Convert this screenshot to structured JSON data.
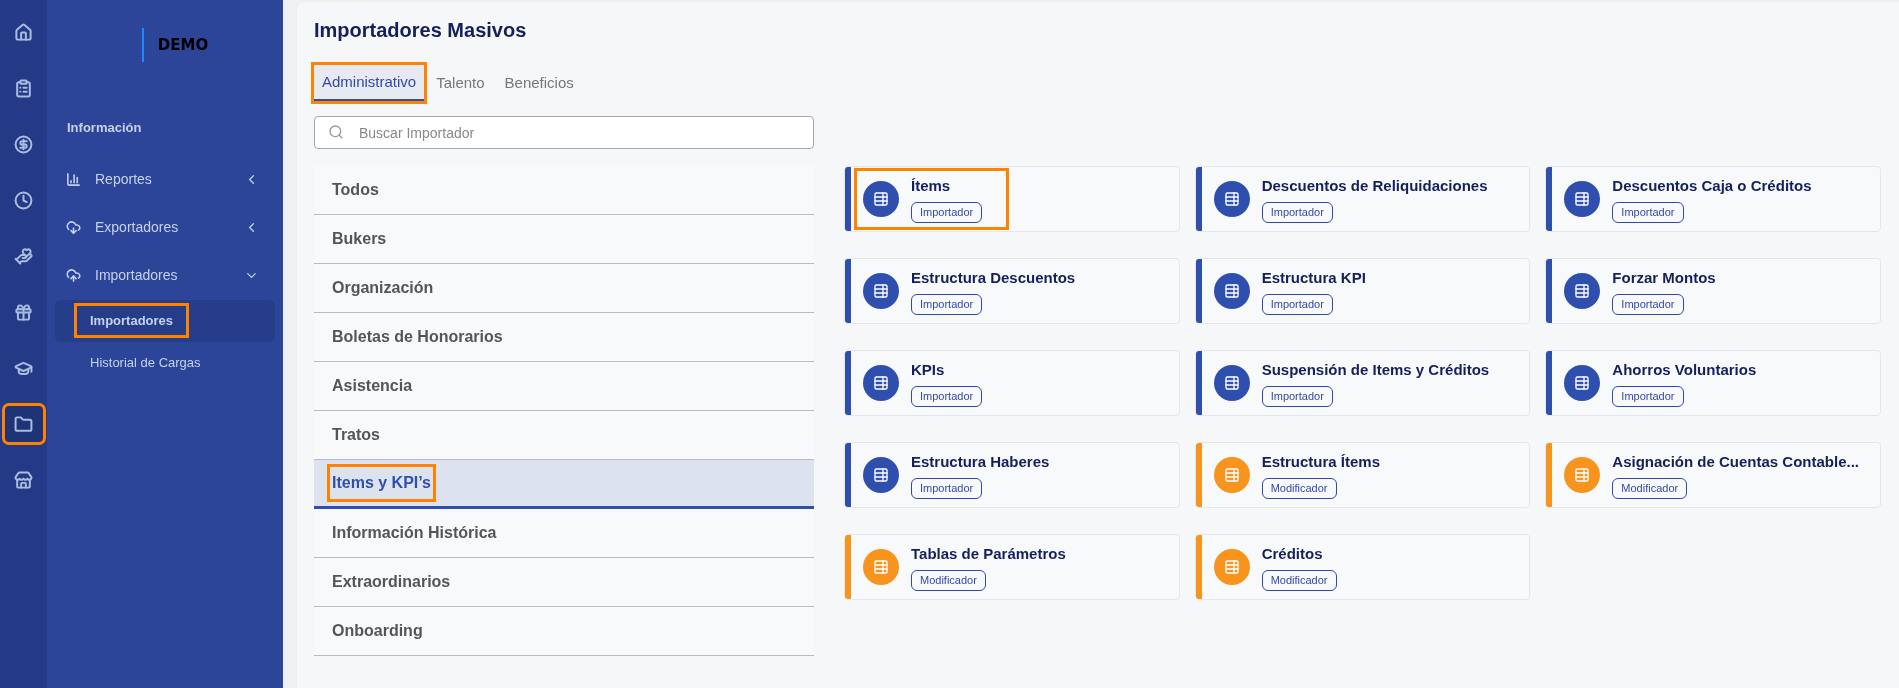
{
  "rail": [
    {
      "selected": false,
      "highlighted": false
    },
    {
      "selected": false,
      "highlighted": false
    },
    {
      "selected": false,
      "highlighted": false
    },
    {
      "selected": false,
      "highlighted": false
    },
    {
      "selected": false,
      "highlighted": false
    },
    {
      "selected": false,
      "highlighted": false
    },
    {
      "selected": false,
      "highlighted": false
    },
    {
      "selected": true,
      "highlighted": true
    },
    {
      "selected": false,
      "highlighted": false
    }
  ],
  "sidebar": {
    "logo": "DEMO",
    "section": "Información",
    "items": [
      {
        "label": "Reportes",
        "expanded": false
      },
      {
        "label": "Exportadores",
        "expanded": false
      },
      {
        "label": "Importadores",
        "expanded": true,
        "children": [
          {
            "label": "Importadores",
            "selected": true,
            "highlighted": true
          },
          {
            "label": "Historial de Cargas",
            "selected": false,
            "highlighted": false
          }
        ]
      }
    ]
  },
  "title": "Importadores Masivos",
  "tabs": [
    {
      "label": "Administrativo",
      "selected": true,
      "highlighted": true
    },
    {
      "label": "Talento",
      "selected": false,
      "highlighted": false
    },
    {
      "label": "Beneficios",
      "selected": false,
      "highlighted": false
    }
  ],
  "search": {
    "placeholder": "Buscar Importador"
  },
  "categories": [
    {
      "label": "Todos",
      "selected": false,
      "highlighted": false
    },
    {
      "label": "Bukers",
      "selected": false,
      "highlighted": false
    },
    {
      "label": "Organización",
      "selected": false,
      "highlighted": false
    },
    {
      "label": "Boletas de Honorarios",
      "selected": false,
      "highlighted": false
    },
    {
      "label": "Asistencia",
      "selected": false,
      "highlighted": false
    },
    {
      "label": "Tratos",
      "selected": false,
      "highlighted": false
    },
    {
      "label": "Items y KPI’s",
      "selected": true,
      "highlighted": true
    },
    {
      "label": "Información Histórica",
      "selected": false,
      "highlighted": false
    },
    {
      "label": "Extraordinarios",
      "selected": false,
      "highlighted": false
    },
    {
      "label": "Onboarding",
      "selected": false,
      "highlighted": false
    }
  ],
  "cards": [
    {
      "title": "Ítems",
      "badge": "Importador",
      "kind": "importer",
      "highlighted": true
    },
    {
      "title": "Descuentos de Reliquidaciones",
      "badge": "Importador",
      "kind": "importer",
      "highlighted": false
    },
    {
      "title": "Descuentos Caja o Créditos",
      "badge": "Importador",
      "kind": "importer",
      "highlighted": false
    },
    {
      "title": "Estructura Descuentos",
      "badge": "Importador",
      "kind": "importer",
      "highlighted": false
    },
    {
      "title": "Estructura KPI",
      "badge": "Importador",
      "kind": "importer",
      "highlighted": false
    },
    {
      "title": "Forzar Montos",
      "badge": "Importador",
      "kind": "importer",
      "highlighted": false
    },
    {
      "title": "KPIs",
      "badge": "Importador",
      "kind": "importer",
      "highlighted": false
    },
    {
      "title": "Suspensión de Items y Créditos",
      "badge": "Importador",
      "kind": "importer",
      "highlighted": false
    },
    {
      "title": "Ahorros Voluntarios",
      "badge": "Importador",
      "kind": "importer",
      "highlighted": false
    },
    {
      "title": "Estructura Haberes",
      "badge": "Importador",
      "kind": "importer",
      "highlighted": false
    },
    {
      "title": "Estructura Ítems",
      "badge": "Modificador",
      "kind": "modifier",
      "highlighted": false
    },
    {
      "title": "Asignación de Cuentas Contable...",
      "badge": "Modificador",
      "kind": "modifier",
      "highlighted": false
    },
    {
      "title": "Tablas de Parámetros",
      "badge": "Modificador",
      "kind": "modifier",
      "highlighted": false
    },
    {
      "title": "Créditos",
      "badge": "Modificador",
      "kind": "modifier",
      "highlighted": false
    }
  ]
}
